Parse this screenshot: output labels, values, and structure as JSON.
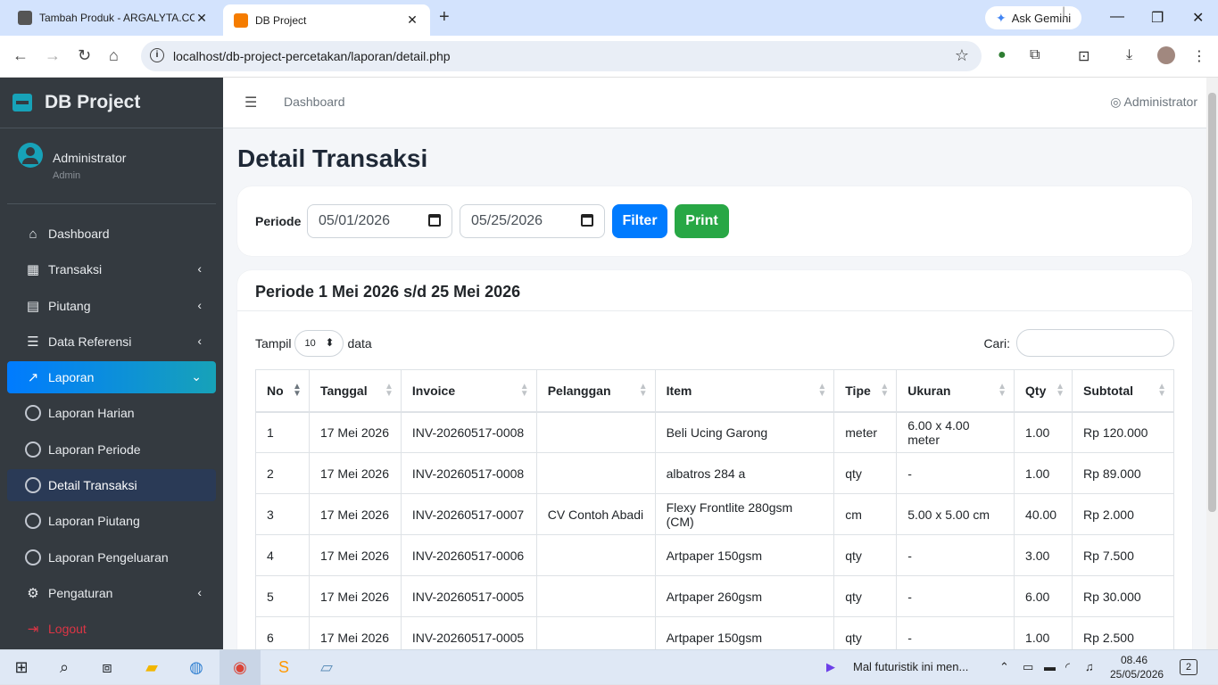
{
  "browser": {
    "tabs": [
      {
        "title": "Tambah Produk - ARGALYTA.CO",
        "active": false
      },
      {
        "title": "DB Project",
        "active": true
      }
    ],
    "gemini_label": "Ask Gemini",
    "url": "localhost/db-project-percetakan/laporan/detail.php"
  },
  "sidebar": {
    "brand": "DB Project",
    "user_name": "Administrator",
    "user_role": "Admin",
    "menu": [
      {
        "label": "Dashboard",
        "icon": "home-icon"
      },
      {
        "label": "Transaksi",
        "icon": "cash-register-icon"
      },
      {
        "label": "Piutang",
        "icon": "invoice-icon"
      },
      {
        "label": "Data Referensi",
        "icon": "database-icon"
      },
      {
        "label": "Laporan",
        "icon": "chart-line-icon"
      },
      {
        "label": "Laporan Harian",
        "icon": "circle-icon"
      },
      {
        "label": "Laporan Periode",
        "icon": "circle-icon"
      },
      {
        "label": "Detail Transaksi",
        "icon": "circle-icon"
      },
      {
        "label": "Laporan Piutang",
        "icon": "circle-icon"
      },
      {
        "label": "Laporan Pengeluaran",
        "icon": "circle-icon"
      },
      {
        "label": "Pengaturan",
        "icon": "cogs-icon"
      },
      {
        "label": "Logout",
        "icon": "logout-icon"
      }
    ]
  },
  "topnav": {
    "dashboard_link": "Dashboard",
    "user": "Administrator"
  },
  "page": {
    "title": "Detail Transaksi",
    "filter": {
      "label": "Periode",
      "date_from": "05/01/2026",
      "date_to": "05/25/2026",
      "filter_button": "Filter",
      "print_button": "Print"
    },
    "report_header": "Periode 1 Mei 2026 s/d 25 Mei 2026",
    "table_controls": {
      "show_prefix": "Tampil",
      "show_value": "10",
      "show_suffix": "data",
      "search_label": "Cari:"
    },
    "columns": [
      "No",
      "Tanggal",
      "Invoice",
      "Pelanggan",
      "Item",
      "Tipe",
      "Ukuran",
      "Qty",
      "Subtotal"
    ],
    "rows": [
      [
        "1",
        "17 Mei 2026",
        "INV-20260517-0008",
        "",
        "Beli Ucing Garong",
        "meter",
        "6.00 x 4.00 meter",
        "1.00",
        "Rp 120.000"
      ],
      [
        "2",
        "17 Mei 2026",
        "INV-20260517-0008",
        "",
        "albatros 284 a",
        "qty",
        "-",
        "1.00",
        "Rp 89.000"
      ],
      [
        "3",
        "17 Mei 2026",
        "INV-20260517-0007",
        "CV Contoh Abadi",
        "Flexy Frontlite 280gsm (CM)",
        "cm",
        "5.00 x 5.00 cm",
        "40.00",
        "Rp 2.000"
      ],
      [
        "4",
        "17 Mei 2026",
        "INV-20260517-0006",
        "",
        "Artpaper 150gsm",
        "qty",
        "-",
        "3.00",
        "Rp 7.500"
      ],
      [
        "5",
        "17 Mei 2026",
        "INV-20260517-0005",
        "",
        "Artpaper 260gsm",
        "qty",
        "-",
        "6.00",
        "Rp 30.000"
      ],
      [
        "6",
        "17 Mei 2026",
        "INV-20260517-0005",
        "",
        "Artpaper 150gsm",
        "qty",
        "-",
        "1.00",
        "Rp 2.500"
      ]
    ]
  },
  "taskbar": {
    "media_title": "Mal futuristik ini men...",
    "time": "08.46",
    "date": "25/05/2026",
    "notifications": "2"
  },
  "colors": {
    "primary": "#007bff",
    "success": "#28a745",
    "sidebar_bg": "#343a40",
    "danger": "#dc3545"
  }
}
